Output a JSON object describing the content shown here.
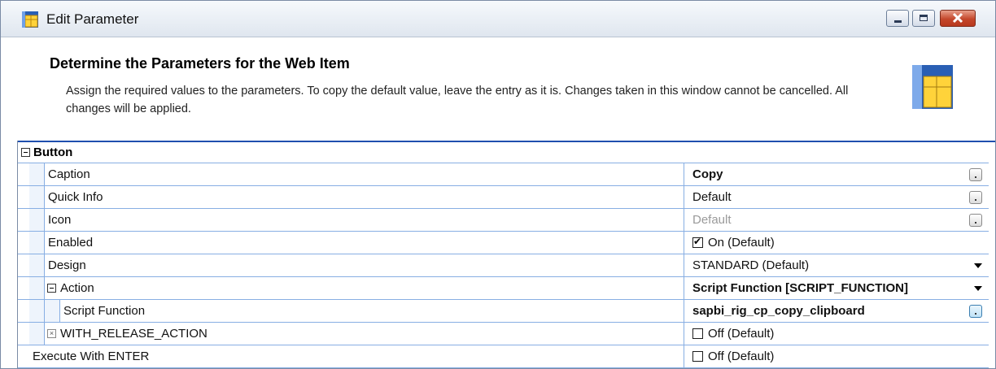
{
  "window": {
    "title": "Edit Parameter"
  },
  "header": {
    "heading": "Determine the Parameters for the Web Item",
    "description": "Assign the required values to the parameters. To copy the default value, leave the entry as it is. Changes taken in this window cannot be cancelled. All changes will be applied."
  },
  "group": {
    "label": "Button"
  },
  "rows": [
    {
      "name": "Caption",
      "value": "Copy"
    },
    {
      "name": "Quick Info",
      "value": "Default"
    },
    {
      "name": "Icon",
      "value": "Default"
    },
    {
      "name": "Enabled",
      "value": "On (Default)",
      "checked": true
    },
    {
      "name": "Design",
      "value": "STANDARD (Default)"
    },
    {
      "name": "Action",
      "value": "Script Function [SCRIPT_FUNCTION]"
    },
    {
      "name": "Script Function",
      "value": "sapbi_rig_cp_copy_clipboard"
    },
    {
      "name": "WITH_RELEASE_ACTION",
      "value": "Off (Default)",
      "checked": false
    },
    {
      "name": "Execute With ENTER",
      "value": "Off (Default)",
      "checked": false
    }
  ],
  "colors": {
    "grid_line": "#87aee3",
    "separator": "#1f4fae",
    "close_button": "#c4472b"
  },
  "icons": {
    "app": "edit-parameter-icon",
    "minimize": "minimize-icon",
    "maximize": "maximize-icon",
    "close": "close-icon"
  }
}
